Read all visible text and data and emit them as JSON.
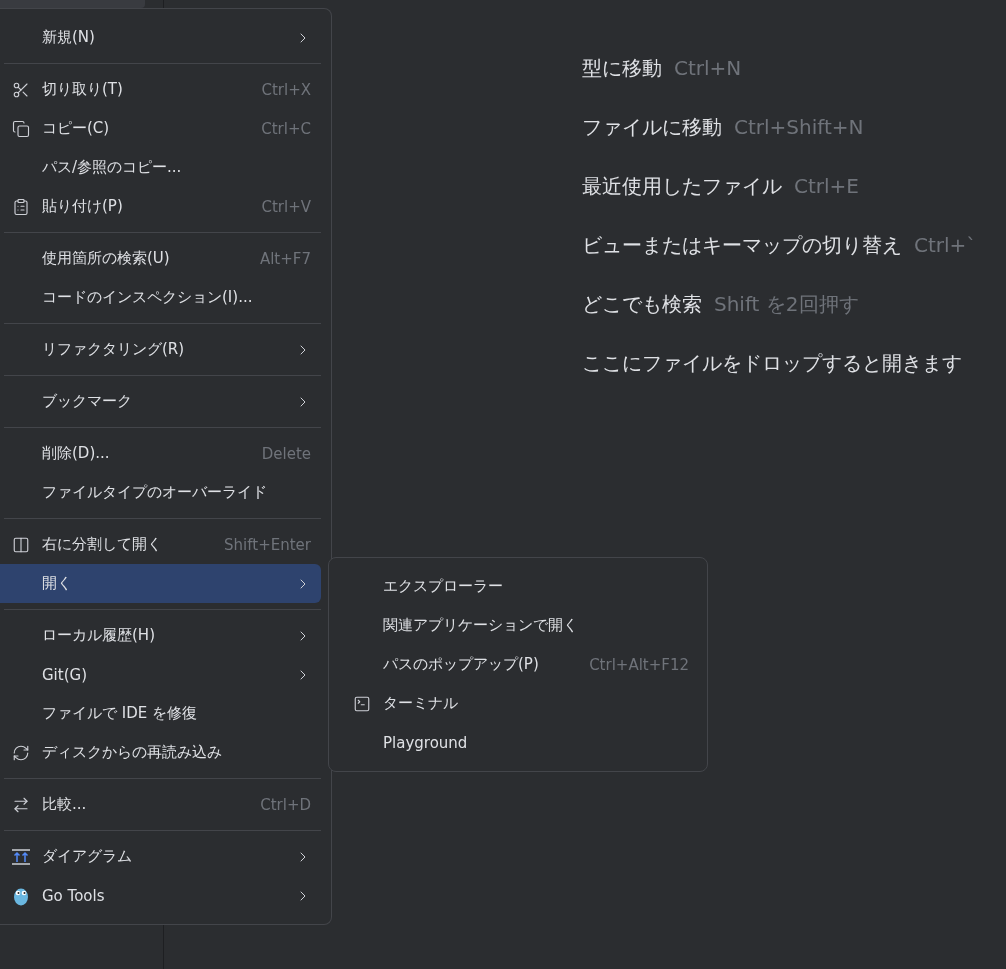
{
  "context_menu": {
    "groups": [
      [
        {
          "label": "新規(N)",
          "has_submenu": true,
          "selected": false
        }
      ],
      [
        {
          "label": "切り取り(T)",
          "shortcut": "Ctrl+X",
          "has_submenu": false,
          "selected": false
        },
        {
          "label": "コピー(C)",
          "shortcut": "Ctrl+C",
          "has_submenu": false,
          "selected": false
        },
        {
          "label": "パス/参照のコピー...",
          "has_submenu": false,
          "selected": false
        },
        {
          "label": "貼り付け(P)",
          "shortcut": "Ctrl+V",
          "has_submenu": false,
          "selected": false
        }
      ],
      [
        {
          "label": "使用箇所の検索(U)",
          "shortcut": "Alt+F7",
          "has_submenu": false,
          "selected": false
        },
        {
          "label": "コードのインスペクション(I)...",
          "has_submenu": false,
          "selected": false
        }
      ],
      [
        {
          "label": "リファクタリング(R)",
          "has_submenu": true,
          "selected": false
        }
      ],
      [
        {
          "label": "ブックマーク",
          "has_submenu": true,
          "selected": false
        }
      ],
      [
        {
          "label": "削除(D)...",
          "shortcut": "Delete",
          "has_submenu": false,
          "selected": false
        },
        {
          "label": "ファイルタイプのオーバーライド",
          "has_submenu": false,
          "selected": false
        }
      ],
      [
        {
          "label": "右に分割して開く",
          "shortcut": "Shift+Enter",
          "has_submenu": false,
          "selected": false
        },
        {
          "label": "開く",
          "has_submenu": true,
          "selected": true
        }
      ],
      [
        {
          "label": "ローカル履歴(H)",
          "has_submenu": true,
          "selected": false
        },
        {
          "label": "Git(G)",
          "has_submenu": true,
          "selected": false
        },
        {
          "label": "ファイルで IDE を修復",
          "has_submenu": false,
          "selected": false
        },
        {
          "label": "ディスクからの再読み込み",
          "has_submenu": false,
          "selected": false
        }
      ],
      [
        {
          "label": "比較...",
          "shortcut": "Ctrl+D",
          "has_submenu": false,
          "selected": false
        }
      ],
      [
        {
          "label": "ダイアグラム",
          "has_submenu": true,
          "selected": false
        },
        {
          "label": "Go Tools",
          "has_submenu": true,
          "selected": false
        }
      ]
    ]
  },
  "submenu": {
    "items": [
      {
        "label": "エクスプローラー"
      },
      {
        "label": "関連アプリケーションで開く"
      },
      {
        "label": "パスのポップアップ(P)",
        "shortcut": "Ctrl+Alt+F12"
      },
      {
        "label": "ターミナル"
      },
      {
        "label": "Playground"
      }
    ]
  },
  "editor_hints": [
    {
      "action": "型に移動",
      "keys": "Ctrl+N"
    },
    {
      "action": "ファイルに移動",
      "keys": "Ctrl+Shift+N"
    },
    {
      "action": "最近使用したファイル",
      "keys": "Ctrl+E"
    },
    {
      "action": "ビューまたはキーマップの切り替え",
      "keys": "Ctrl+`"
    },
    {
      "action": "どこでも検索",
      "keys": "Shift を2回押す"
    },
    {
      "action": "ここにファイルをドロップすると開きます"
    }
  ]
}
